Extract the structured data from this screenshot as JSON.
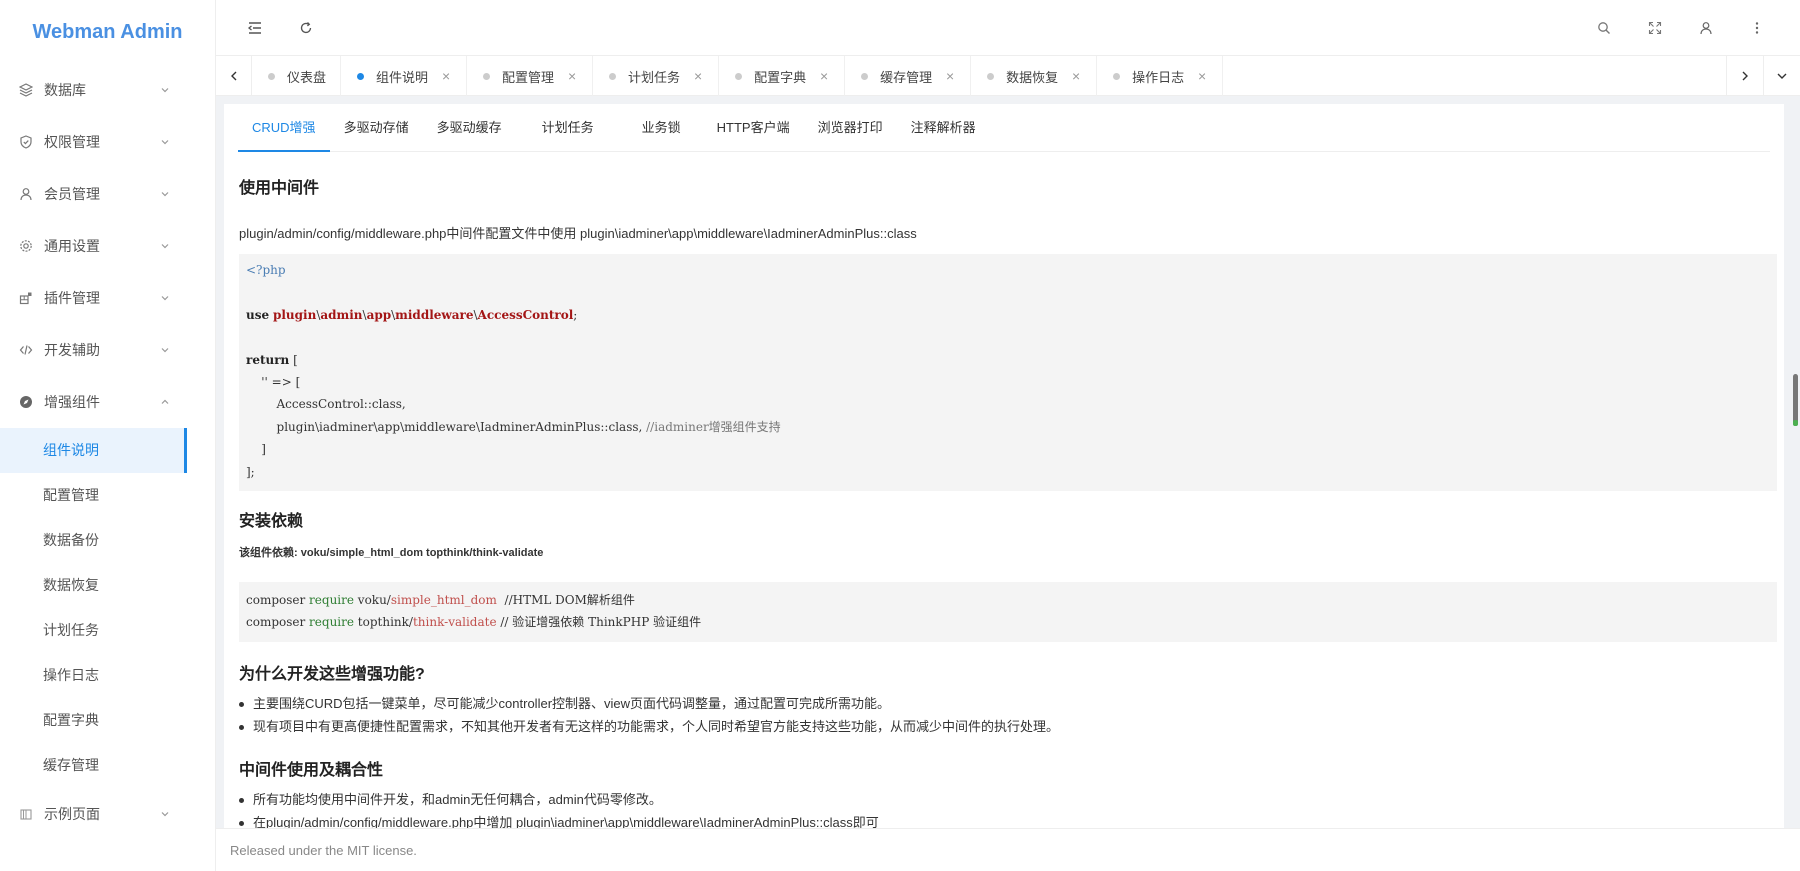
{
  "app": {
    "title": "Webman Admin"
  },
  "sidebar": {
    "items": [
      {
        "label": "数据库",
        "icon": "layers-icon"
      },
      {
        "label": "权限管理",
        "icon": "shield-icon"
      },
      {
        "label": "会员管理",
        "icon": "user-icon"
      },
      {
        "label": "通用设置",
        "icon": "gear-icon"
      },
      {
        "label": "插件管理",
        "icon": "puzzle-icon"
      },
      {
        "label": "开发辅助",
        "icon": "code-icon"
      },
      {
        "label": "增强组件",
        "icon": "compass-icon",
        "expanded": true
      }
    ],
    "submenu": [
      {
        "label": "组件说明",
        "active": true
      },
      {
        "label": "配置管理"
      },
      {
        "label": "数据备份"
      },
      {
        "label": "数据恢复"
      },
      {
        "label": "计划任务"
      },
      {
        "label": "操作日志"
      },
      {
        "label": "配置字典"
      },
      {
        "label": "缓存管理"
      }
    ],
    "last_item": {
      "label": "示例页面",
      "icon": "page-icon"
    }
  },
  "tabs": [
    {
      "label": "仪表盘",
      "closable": false
    },
    {
      "label": "组件说明",
      "active": true,
      "closable": true
    },
    {
      "label": "配置管理",
      "closable": true
    },
    {
      "label": "计划任务",
      "closable": true
    },
    {
      "label": "配置字典",
      "closable": true
    },
    {
      "label": "缓存管理",
      "closable": true
    },
    {
      "label": "数据恢复",
      "closable": true
    },
    {
      "label": "操作日志",
      "closable": true
    }
  ],
  "subtabs": [
    "CRUD增强",
    "多驱动存储",
    "多驱动缓存",
    "计划任务",
    "业务锁",
    "HTTP客户端",
    "浏览器打印",
    "注释解析器"
  ],
  "doc": {
    "h_middleware": "使用中间件",
    "p_middleware": "plugin/admin/config/middleware.php中间件配置文件中使用 plugin\\iadminer\\app\\middleware\\IadminerAdminPlus::class",
    "code1": {
      "open_tag": "<?php",
      "use_kw": "use",
      "ns_parts": [
        "plugin",
        "admin",
        "app",
        "middleware",
        "AccessControl"
      ],
      "sep": "\\",
      "semi": ";",
      "return_kw": "return",
      "return_rest": " [",
      "key_line": "    '' => [",
      "line_access": "        AccessControl::class,",
      "line_plus": "        plugin\\iadminer\\app\\middleware\\IadminerAdminPlus::class, ",
      "line_plus_comment": "//iadminer增强组件支持",
      "inner_close": "    ]",
      "outer_close": "];"
    },
    "h_deps": "安装依赖",
    "p_deps_label": "该组件依赖:",
    "p_deps_value": "voku/simple_html_dom topthink/think-validate",
    "code2": {
      "cmd": "composer ",
      "req": "require",
      "l1_vendor": " voku/",
      "l1_pkg": "simple_html_dom",
      "l1_comment": "  //HTML DOM解析组件",
      "l2_vendor": " topthink/",
      "l2_pkg": "think-validate",
      "l2_comment": " // 验证增强依赖 ThinkPHP 验证组件"
    },
    "h_why": "为什么开发这些增强功能?",
    "why_items": [
      "主要围绕CURD包括一键菜单，尽可能减少controller控制器、view页面代码调整量，通过配置可完成所需功能。",
      "现有项目中有更高便捷性配置需求，不知其他开发者有无这样的功能需求，个人同时希望官方能支持这些功能，从而减少中间件的执行处理。"
    ],
    "h_coupling": "中间件使用及耦合性",
    "coupling_items": [
      "所有功能均使用中间件开发，和admin无任何耦合，admin代码零修改。",
      "在plugin/admin/config/middleware.php中增加 plugin\\iadminer\\app\\middleware\\IadminerAdminPlus::class即可"
    ]
  },
  "footer": {
    "text": "Released under the MIT license."
  }
}
